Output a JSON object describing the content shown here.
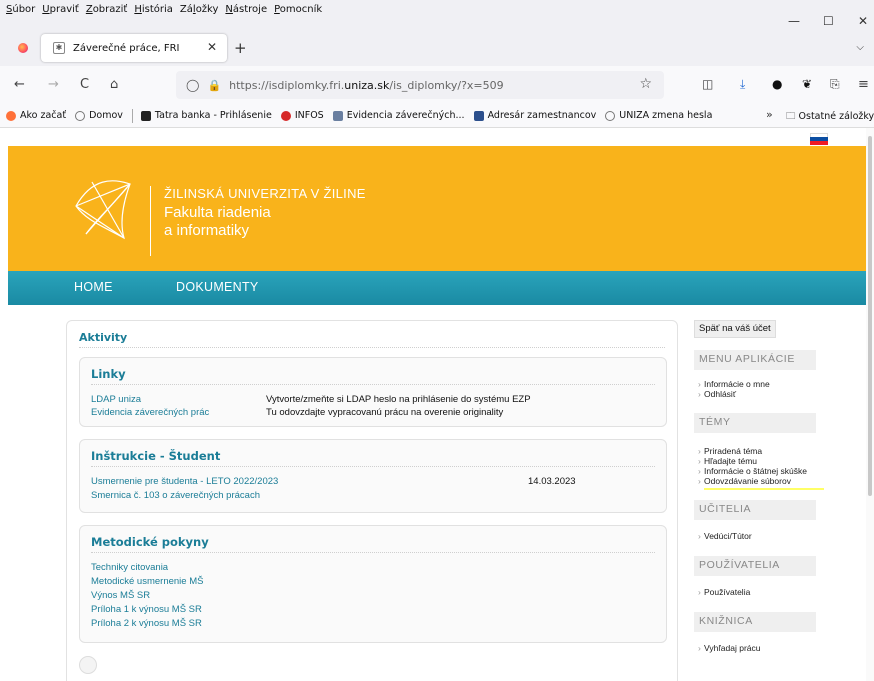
{
  "menu": [
    "Súbor",
    "Upraviť",
    "Zobraziť",
    "História",
    "Záložky",
    "Nástroje",
    "Pomocník"
  ],
  "menu_keys": [
    "S",
    "U",
    "Z",
    "H",
    "l",
    "N",
    "P"
  ],
  "window": {
    "minimize": "—",
    "maximize": "☐",
    "close": "✕"
  },
  "tab": {
    "title": "Záverečné práce, FRI",
    "close": "✕",
    "new_tab": "+",
    "list": "⌵"
  },
  "nav": {
    "back": "←",
    "forward": "→",
    "reload": "C",
    "home": "⌂"
  },
  "url": {
    "prefix": "https://isdiplomky.fri.",
    "host": "uniza.sk",
    "path": "/is_diplomky/?x=509"
  },
  "toolbar_icons": [
    "pocket-icon",
    "download-icon",
    "shield-icon",
    "extension-icon",
    "share-icon",
    "menu-icon"
  ],
  "toolbar_glyphs": [
    "◫",
    "⤓",
    "●",
    "❦",
    "⎘",
    "≡"
  ],
  "bookmarks": [
    {
      "label": "Ako začať",
      "color": "#ff7139"
    },
    {
      "label": "Domov",
      "color": "#777777"
    },
    {
      "label": "Tatra banka - Prihlásenie",
      "color": "#222222"
    },
    {
      "label": "INFOS",
      "color": "#d62828"
    },
    {
      "label": "Evidencia záverečných...",
      "color": "#6a7fa0"
    },
    {
      "label": "Adresár zamestnancov",
      "color": "#2c4f8c"
    },
    {
      "label": "UNIZA zmena hesla",
      "color": "#777777"
    }
  ],
  "bookmarks_more": "»",
  "bookmarks_other": "Ostatné záložky",
  "header": {
    "university": "ŽILINSKÁ UNIVERZITA V ŽILINE",
    "faculty_line1": "Fakulta riadenia",
    "faculty_line2": "a informatiky"
  },
  "mainnav": [
    "HOME",
    "DOKUMENTY"
  ],
  "activities_title": "Aktivity",
  "links_section": {
    "title": "Linky",
    "rows": [
      {
        "link": "LDAP uniza",
        "desc": "Vytvorte/zmeňte si LDAP heslo na prihlásenie do systému EZP"
      },
      {
        "link": "Evidencia záverečných prác",
        "desc": "Tu odovzdajte vypracovanú prácu na overenie originality"
      }
    ]
  },
  "instructions_section": {
    "title": "Inštrukcie - Študent",
    "rows": [
      {
        "link": "Usmernenie pre študenta - LETO 2022/2023",
        "date": "14.03.2023"
      },
      {
        "link": "Smernica č. 103 o záverečných prácach",
        "date": ""
      }
    ]
  },
  "methodic_section": {
    "title": "Metodické pokyny",
    "links": [
      "Techniky citovania",
      "Metodické usmernenie MŠ",
      "Výnos MŠ SR",
      "Príloha 1 k výnosu MŠ SR",
      "Príloha 2 k výnosu MŠ SR"
    ]
  },
  "sidebar": {
    "back": "Späť na váš účet",
    "groups": [
      {
        "title": "MENU APLIKÁCIE",
        "items": [
          "Informácie o mne",
          "Odhlásiť"
        ]
      },
      {
        "title": "TÉMY",
        "items": [
          "Priradená téma",
          "Hľadajte tému",
          "Informácie o štátnej skúške",
          "Odovzdávanie súborov"
        ]
      },
      {
        "title": "UČITELIA",
        "items": [
          "Vedúci/Tútor"
        ]
      },
      {
        "title": "POUŽÍVATELIA",
        "items": [
          "Používatelia"
        ]
      },
      {
        "title": "KNIŽNICA",
        "items": [
          "Vyhľadaj prácu"
        ]
      }
    ]
  },
  "colors": {
    "banner": "#f9b31b",
    "nav": "#1f95ae",
    "link": "#1b7d97",
    "highlight": "#ffff66"
  }
}
